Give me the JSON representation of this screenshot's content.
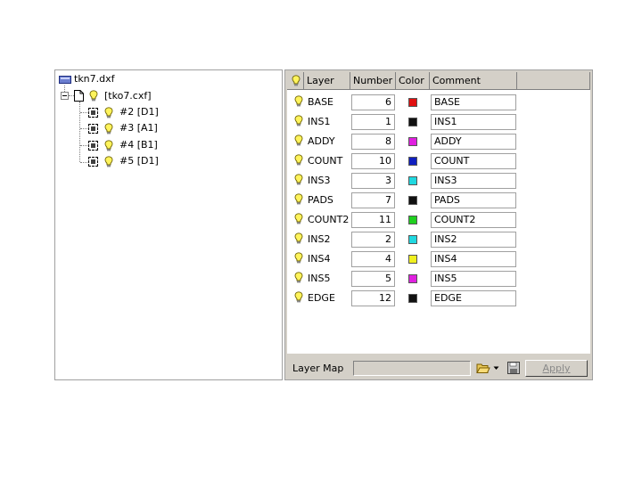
{
  "tree": {
    "root_label": "tkn7.dxf",
    "child_label": "[tko7.cxf]",
    "nodes": [
      "#2 [D1]",
      "#3 [A1]",
      "#4 [B1]",
      "#5 [D1]"
    ]
  },
  "grid": {
    "headers": {
      "layer": "Layer",
      "number": "Number",
      "color": "Color",
      "comment": "Comment"
    },
    "rows": [
      {
        "layer": "BASE",
        "number": "6",
        "color": "#e01010",
        "comment": "BASE"
      },
      {
        "layer": "INS1",
        "number": "1",
        "color": "#111111",
        "comment": "INS1"
      },
      {
        "layer": "ADDY",
        "number": "8",
        "color": "#e020e0",
        "comment": "ADDY"
      },
      {
        "layer": "COUNT",
        "number": "10",
        "color": "#1020c0",
        "comment": "COUNT"
      },
      {
        "layer": "INS3",
        "number": "3",
        "color": "#20d8e0",
        "comment": "INS3"
      },
      {
        "layer": "PADS",
        "number": "7",
        "color": "#111111",
        "comment": "PADS"
      },
      {
        "layer": "COUNT2",
        "number": "11",
        "color": "#20d020",
        "comment": "COUNT2"
      },
      {
        "layer": "INS2",
        "number": "2",
        "color": "#20d8e0",
        "comment": "INS2"
      },
      {
        "layer": "INS4",
        "number": "4",
        "color": "#f0f020",
        "comment": "INS4"
      },
      {
        "layer": "INS5",
        "number": "5",
        "color": "#e020e0",
        "comment": "INS5"
      },
      {
        "layer": "EDGE",
        "number": "12",
        "color": "#111111",
        "comment": "EDGE"
      }
    ]
  },
  "bottom": {
    "layer_map_label": "Layer Map",
    "layer_map_value": "",
    "apply_label": "Apply"
  },
  "icons": {
    "bulb": "lightbulb-icon",
    "document": "document-icon",
    "drive": "drive-icon",
    "open": "open-folder-icon",
    "save": "save-icon"
  }
}
